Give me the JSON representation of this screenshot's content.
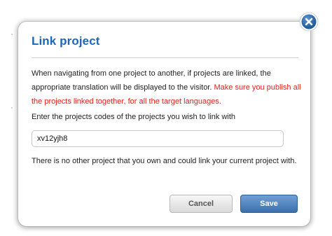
{
  "dialog": {
    "title": "Link project",
    "intro_text": "When navigating from one project to another, if projects are linked, the appropriate translation will be displayed to the visitor.",
    "warning_text": "Make sure you publish all the projects linked together, for all the target languages.",
    "prompt_label": "Enter the projects codes of the projects you wish to link with",
    "project_code_value": "xv12yjh8",
    "info_text": "There is no other project that you own and could link your current project with.",
    "cancel_label": "Cancel",
    "save_label": "Save"
  },
  "colors": {
    "title": "#1e66b8",
    "warning": "#e3221a",
    "save_button": "#4a7fbf",
    "close_button": "#1f5d99"
  },
  "icons": {
    "close": "close-icon"
  }
}
